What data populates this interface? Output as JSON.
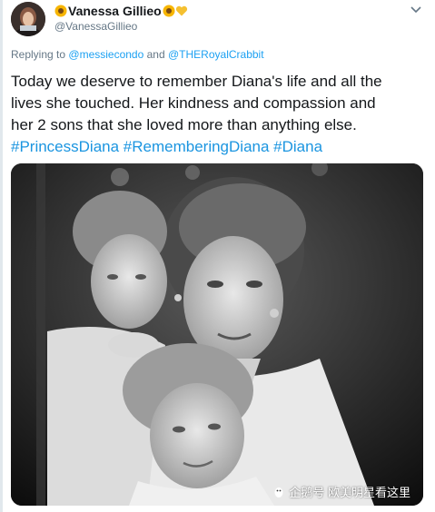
{
  "author": {
    "display_name": "Vanessa Gillieo",
    "handle": "@VanessaGillieo",
    "name_emojis": [
      "sunflower-emoji",
      "sunflower-emoji",
      "yellow-heart-emoji"
    ]
  },
  "reply": {
    "prefix": "Replying to",
    "mention_1": "@messiecondo",
    "conjunction": "and",
    "mention_2": "@THERoyalCrabbit"
  },
  "tweet": {
    "line_1": "Today we deserve to remember Diana's life and all the",
    "line_2": "lives she touched. Her kindness and compassion and",
    "line_3": "her 2 sons that she loved more than anything else.",
    "hashtag_1": "#PrincessDiana",
    "hashtag_2": "#RememberingDiana",
    "hashtag_3": "#Diana"
  },
  "media": {
    "kind": "black-and-white photo",
    "watermark": "企鹅号 欧美明星看这里"
  },
  "icons": {
    "more": "chevron-down-icon",
    "watermark": "penguin-logo-icon"
  },
  "colors": {
    "link": "#1da1f2",
    "hashtag": "#1b95e0",
    "secondary_text": "#657786",
    "primary_text": "#14171a"
  }
}
